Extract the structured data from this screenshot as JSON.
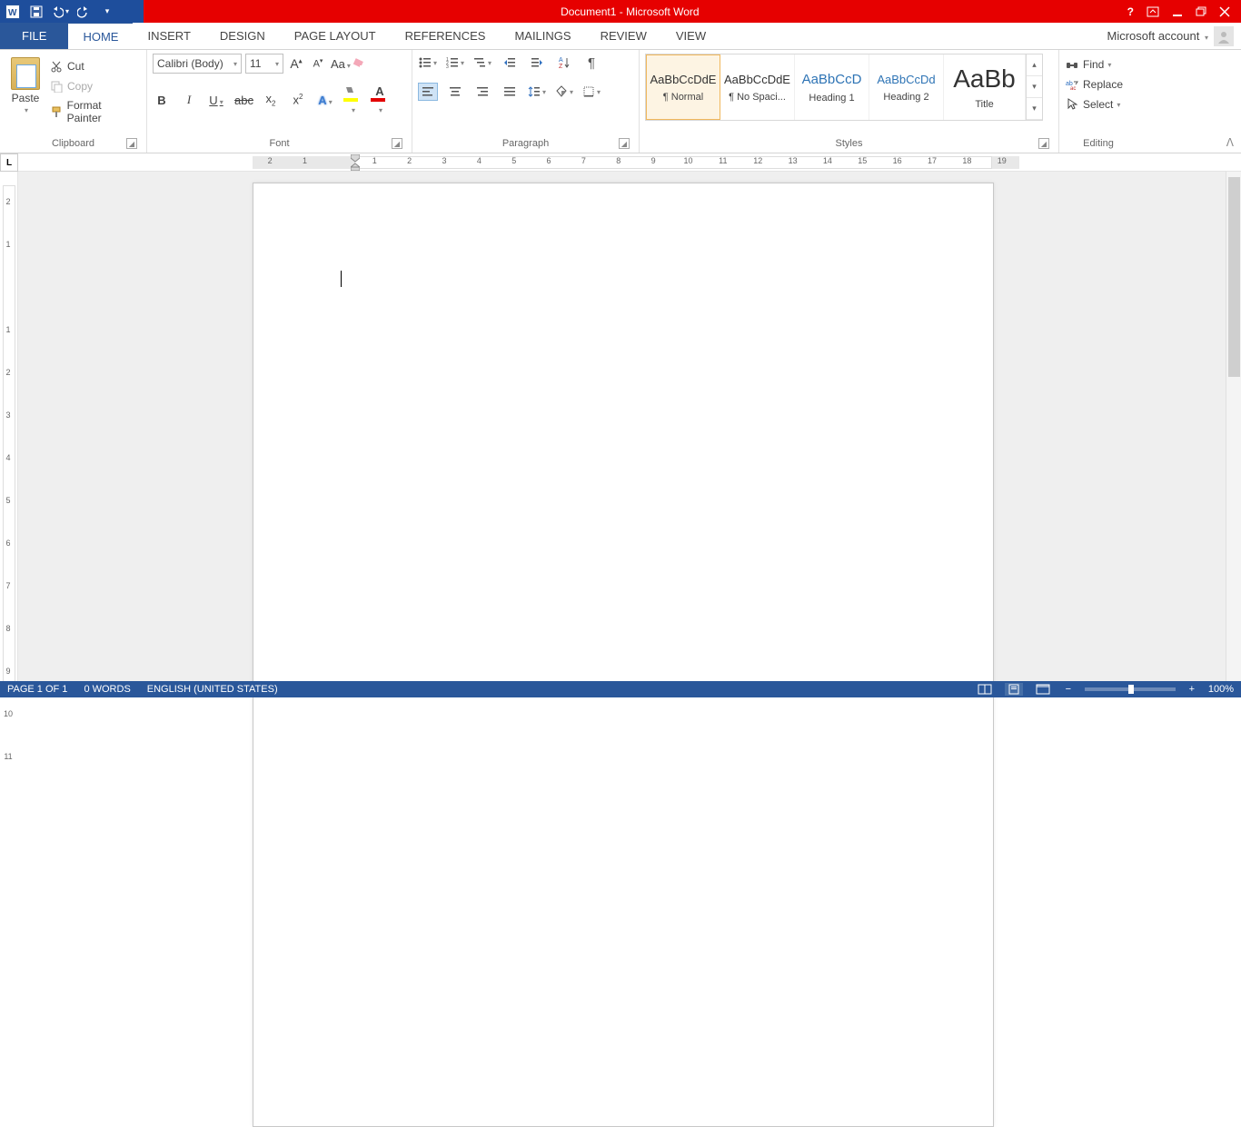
{
  "title": "Document1 -  Microsoft Word",
  "account": "Microsoft account",
  "tabs": {
    "file": "FILE",
    "home": "HOME",
    "insert": "INSERT",
    "design": "DESIGN",
    "page_layout": "PAGE LAYOUT",
    "references": "REFERENCES",
    "mailings": "MAILINGS",
    "review": "REVIEW",
    "view": "VIEW"
  },
  "clipboard": {
    "paste": "Paste",
    "cut": "Cut",
    "copy": "Copy",
    "painter": "Format Painter",
    "label": "Clipboard"
  },
  "font": {
    "name": "Calibri (Body)",
    "size": "11",
    "label": "Font"
  },
  "paragraph": {
    "label": "Paragraph"
  },
  "styles": {
    "label": "Styles",
    "items": [
      {
        "prev": "AaBbCcDdE",
        "name": "¶ Normal"
      },
      {
        "prev": "AaBbCcDdE",
        "name": "¶ No Spaci..."
      },
      {
        "prev": "AaBbCcD",
        "name": "Heading 1"
      },
      {
        "prev": "AaBbCcDd",
        "name": "Heading 2"
      },
      {
        "prev": "AaBb",
        "name": "Title"
      }
    ]
  },
  "editing": {
    "find": "Find",
    "replace": "Replace",
    "select": "Select",
    "label": "Editing"
  },
  "ruler_h": [
    "2",
    "1",
    "",
    "1",
    "2",
    "3",
    "4",
    "5",
    "6",
    "7",
    "8",
    "9",
    "10",
    "11",
    "12",
    "13",
    "14",
    "15",
    "16",
    "17",
    "18",
    "19"
  ],
  "ruler_v": [
    "2",
    "1",
    "",
    "1",
    "2",
    "3",
    "4",
    "5",
    "6",
    "7",
    "8",
    "9",
    "10",
    "11"
  ],
  "status": {
    "page": "PAGE 1 OF 1",
    "words": "0 WORDS",
    "lang": "ENGLISH (UNITED STATES)",
    "zoom": "100%"
  }
}
